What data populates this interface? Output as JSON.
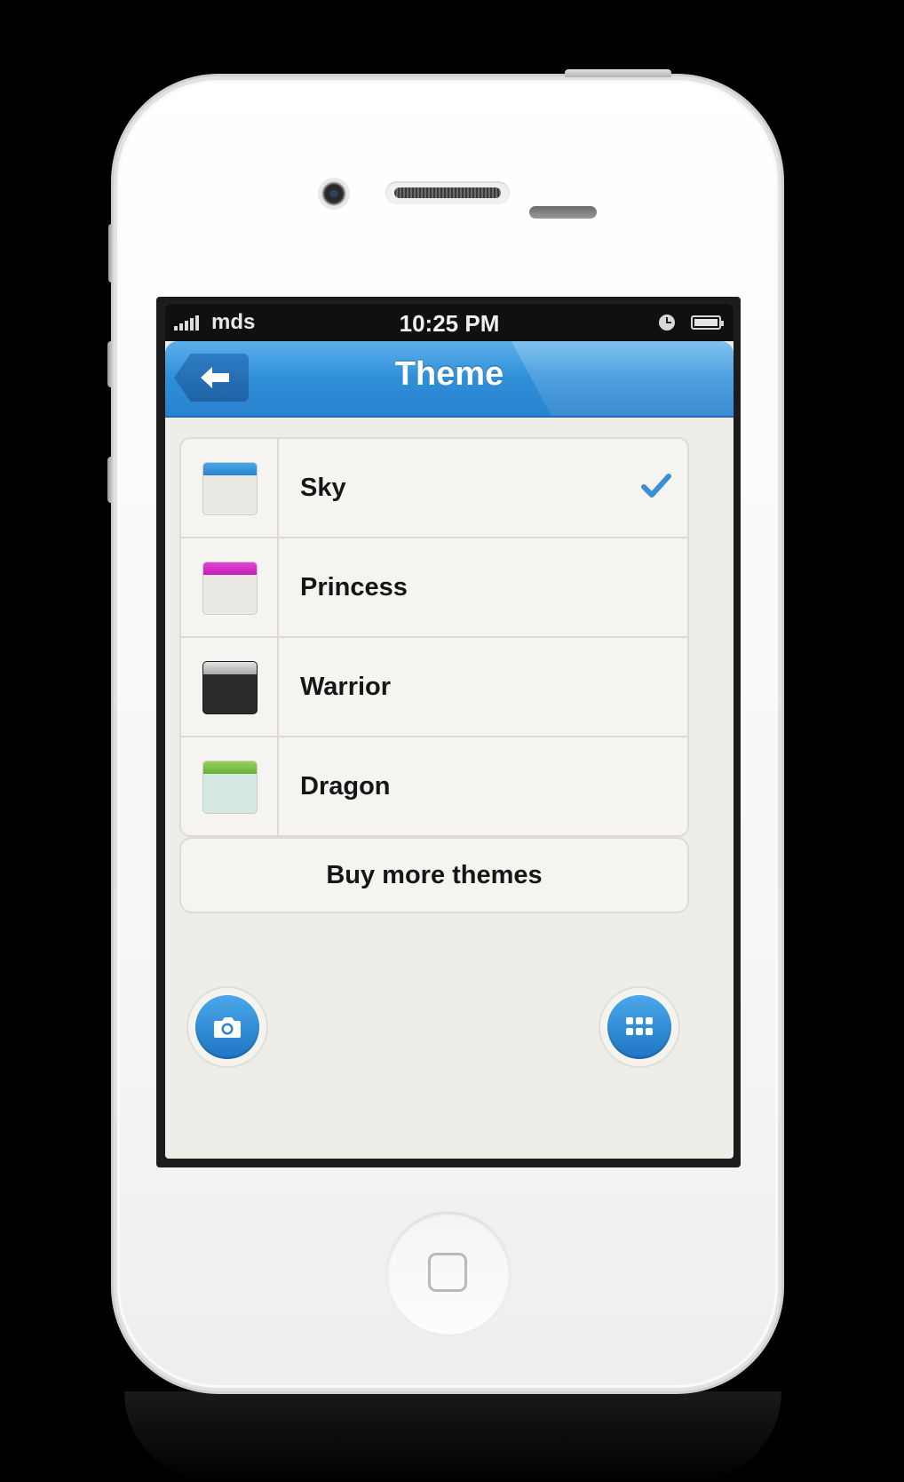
{
  "status_bar": {
    "carrier": "mds",
    "time": "10:25 PM"
  },
  "navbar": {
    "title": "Theme"
  },
  "themes": {
    "items": [
      {
        "label": "Sky",
        "color": "#2f8fd9",
        "selected": true
      },
      {
        "label": "Princess",
        "color": "#d62bc8",
        "selected": false
      },
      {
        "label": "Warrior",
        "color": "#3a3a3a",
        "selected": false
      },
      {
        "label": "Dragon",
        "color": "#7fc24a",
        "selected": false
      }
    ]
  },
  "buy_button": {
    "label": "Buy more themes"
  },
  "actions": {
    "camera_icon": "camera-icon",
    "grid_icon": "grid-icon"
  },
  "accent_color": "#2f8fd9"
}
